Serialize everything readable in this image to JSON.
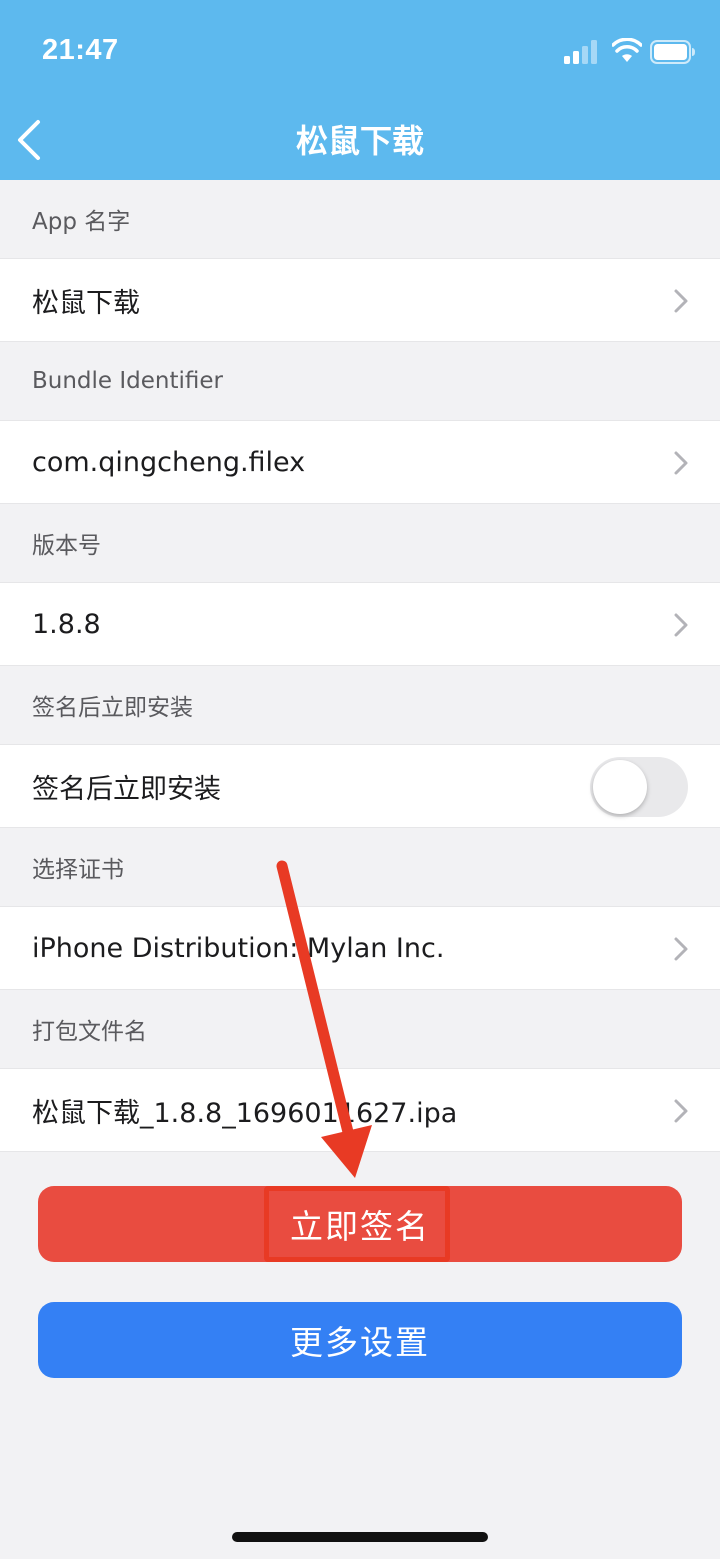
{
  "status_bar": {
    "time": "21:47"
  },
  "nav": {
    "title": "松鼠下载"
  },
  "sections": {
    "app_name": {
      "header": "App 名字",
      "value": "松鼠下载"
    },
    "bundle_id": {
      "header": "Bundle Identifier",
      "value": "com.qingcheng.filex"
    },
    "version": {
      "header": "版本号",
      "value": "1.8.8"
    },
    "install": {
      "header": "签名后立即安装",
      "value": "签名后立即安装",
      "toggle_on": false
    },
    "certificate": {
      "header": "选择证书",
      "value": "iPhone Distribution: Mylan Inc."
    },
    "package": {
      "header": "打包文件名",
      "value": "松鼠下载_1.8.8_1696011627.ipa"
    }
  },
  "buttons": {
    "sign": "立即签名",
    "more": "更多设置"
  },
  "colors": {
    "header_bg": "#5db9ee",
    "sign_button": "#e94c40",
    "more_button": "#3480f4",
    "annotation": "#e83a24"
  }
}
